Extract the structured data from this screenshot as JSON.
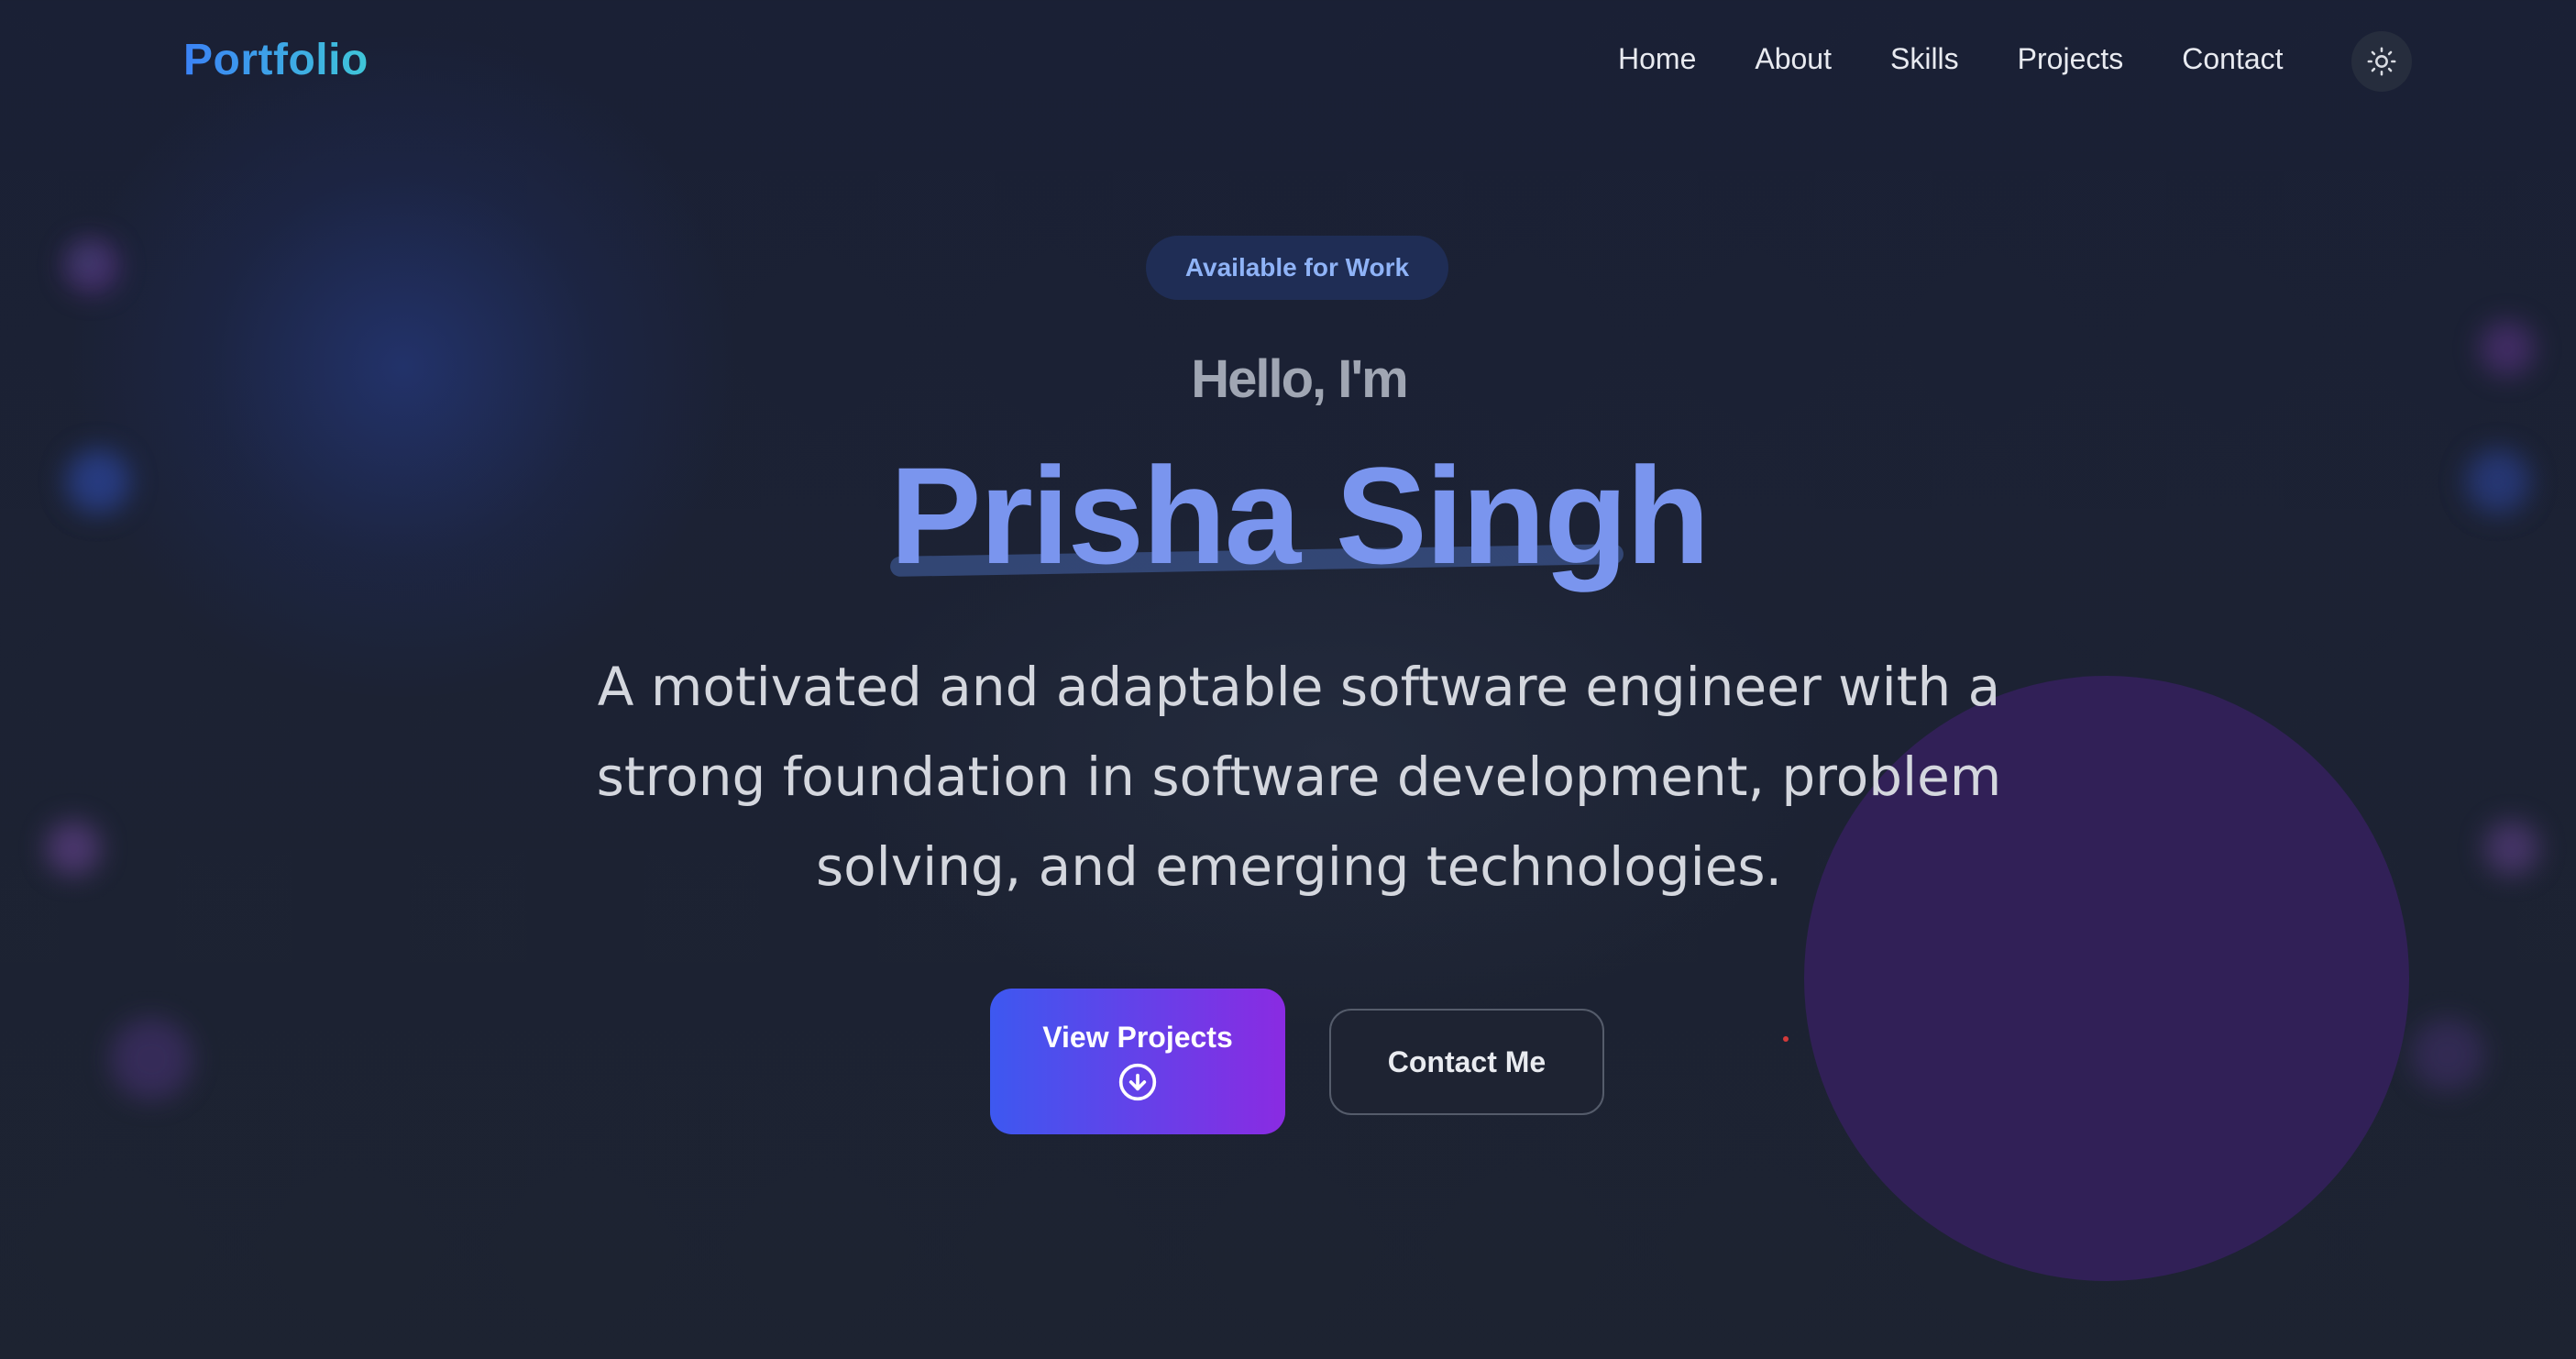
{
  "navbar": {
    "brand": "Portfolio",
    "links": [
      "Home",
      "About",
      "Skills",
      "Projects",
      "Contact"
    ],
    "theme_toggle_icon": "sun-icon"
  },
  "hero": {
    "badge": "Available for Work",
    "greeting": "Hello, I'm",
    "name": "Prisha Singh",
    "tagline": "A motivated and adaptable software engineer with a strong foundation in software development, problem solving, and emerging technologies.",
    "primary_button": {
      "label": "View Projects",
      "icon": "arrow-down-circle-icon"
    },
    "secondary_button": {
      "label": "Contact Me"
    }
  },
  "colors": {
    "background": "#1a2035",
    "brand_gradient_start": "#3b82f6",
    "brand_gradient_end": "#3fc6d8",
    "name": "#7a95ee",
    "primary_button_start": "#3d58f0",
    "primary_button_end": "#8a2be2",
    "badge_bg": "#1f2d55",
    "badge_text": "#8fb3f7",
    "decor_circle": "#33215a"
  }
}
